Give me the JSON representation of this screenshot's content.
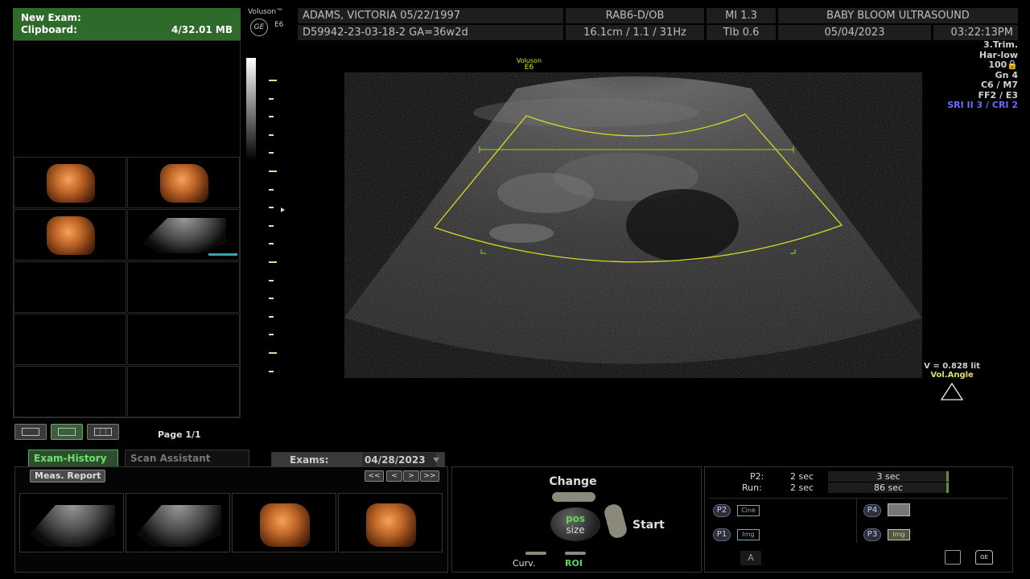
{
  "clipboard": {
    "title_line1": "New Exam:",
    "title_line2": "Clipboard:",
    "size": "4/32.01 MB"
  },
  "page": {
    "label": "Page 1/1"
  },
  "header": {
    "logo": "Voluson™",
    "model": "E6",
    "patient": "ADAMS, VICTORIA  05/22/1997",
    "probe": "RAB6-D/OB",
    "mi": "MI  1.3",
    "clinic": "BABY BLOOM ULTRASOUND",
    "exam_id": "D59942-23-03-18-2  GA=36w2d",
    "depth": "16.1cm / 1.1 / 31Hz",
    "tib": "TIb  0.6",
    "date": "05/04/2023",
    "time": "03:22:13PM"
  },
  "image": {
    "brand": "Voluson",
    "model": "E6"
  },
  "params": [
    "3.Trim.",
    "Har-low",
    "100🔒",
    "Gn    4",
    "C6 / M7",
    "FF2 / E3"
  ],
  "params_blue": "SRI II 3 / CRI 2",
  "volume": {
    "value": "V = 0.828 lit",
    "angle_label": "Vol.Angle"
  },
  "tabs": {
    "exam_history": "Exam-History",
    "scan_assistant": "Scan Assistant",
    "exams_label": "Exams:",
    "exams_date": "04/28/2023"
  },
  "exam_panel": {
    "meas_report": "Meas. Report",
    "nav": [
      "<<",
      "<",
      ">",
      ">>"
    ]
  },
  "touch": {
    "change": "Change",
    "pos": "pos",
    "size": "size",
    "start": "Start",
    "curv": "Curv.",
    "roi": "ROI"
  },
  "ppanel": {
    "p2_label": "P2:",
    "p2_val1": "2 sec",
    "p2_val2": "3 sec",
    "run_label": "Run:",
    "run_val1": "2 sec",
    "run_val2": "86 sec",
    "buttons": [
      {
        "id": "P2",
        "label": "Cine"
      },
      {
        "id": "P4",
        "label": ""
      },
      {
        "id": "P1",
        "label": "Img"
      },
      {
        "id": "P3",
        "label": "Img"
      }
    ],
    "a_label": "A"
  },
  "colors": {
    "clip_green": "#2e6a2a",
    "roi_yellow": "#d8d820",
    "tab_green": "#5ac85a"
  }
}
